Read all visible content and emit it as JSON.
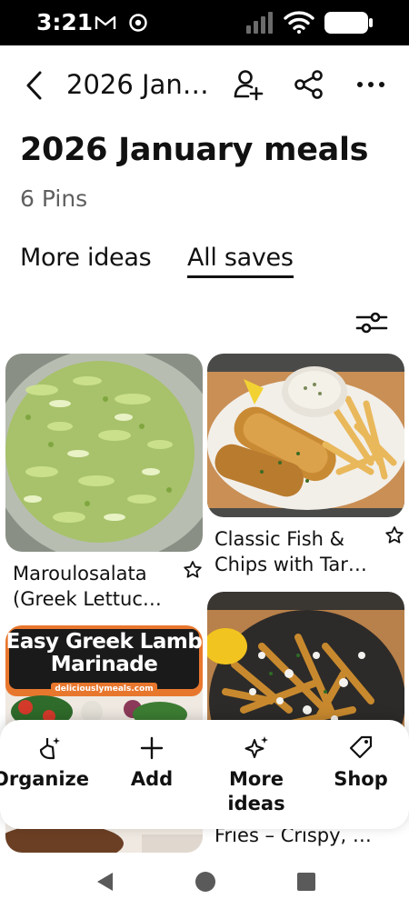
{
  "status_bar": {
    "time": "3:21",
    "left_icons": [
      "gmail-icon",
      "chrome-icon"
    ],
    "right_icons": [
      "signal-icon",
      "wifi-icon",
      "battery-icon"
    ]
  },
  "header": {
    "back_icon": "chevron-left-icon",
    "breadcrumb": "2026 Jan…",
    "icons": [
      "add-collaborator-icon",
      "share-icon",
      "more-icon"
    ]
  },
  "board": {
    "title": "2026 January meals",
    "pin_count": "6 Pins"
  },
  "tabs": [
    {
      "label": "More ideas",
      "active": false
    },
    {
      "label": "All saves",
      "active": true
    }
  ],
  "filter_icon": "sliders-icon",
  "pins": [
    {
      "caption_line1": "Maroulosalata",
      "caption_line2": "(Greek Lettuc…",
      "image": "lettuce-salad"
    },
    {
      "caption_line1": "Classic Fish &",
      "caption_line2": "Chips with Tar…",
      "image": "fish-and-chips"
    },
    {
      "overlay_title_line1": "Easy Greek Lamb",
      "overlay_title_line2": "Marinade",
      "overlay_site": "deliciouslymeals.com",
      "image": "greek-lamb"
    },
    {
      "caption_line1": "Fries – Crispy, …",
      "image": "feta-fries"
    }
  ],
  "dock": [
    {
      "label": "Organize",
      "icon": "broom-sparkle-icon"
    },
    {
      "label": "Add",
      "icon": "plus-icon"
    },
    {
      "label_line1": "More",
      "label_line2": "ideas",
      "icon": "sparkles-icon"
    },
    {
      "label": "Shop",
      "icon": "tag-icon"
    }
  ],
  "nav": {
    "icons": [
      "back-triangle-icon",
      "home-circle-icon",
      "recents-square-icon"
    ]
  },
  "colors": {
    "text": "#111111",
    "muted": "#5f5f5f",
    "overlay_banner": "#1a1a1a",
    "overlay_accent": "#e8772e"
  }
}
